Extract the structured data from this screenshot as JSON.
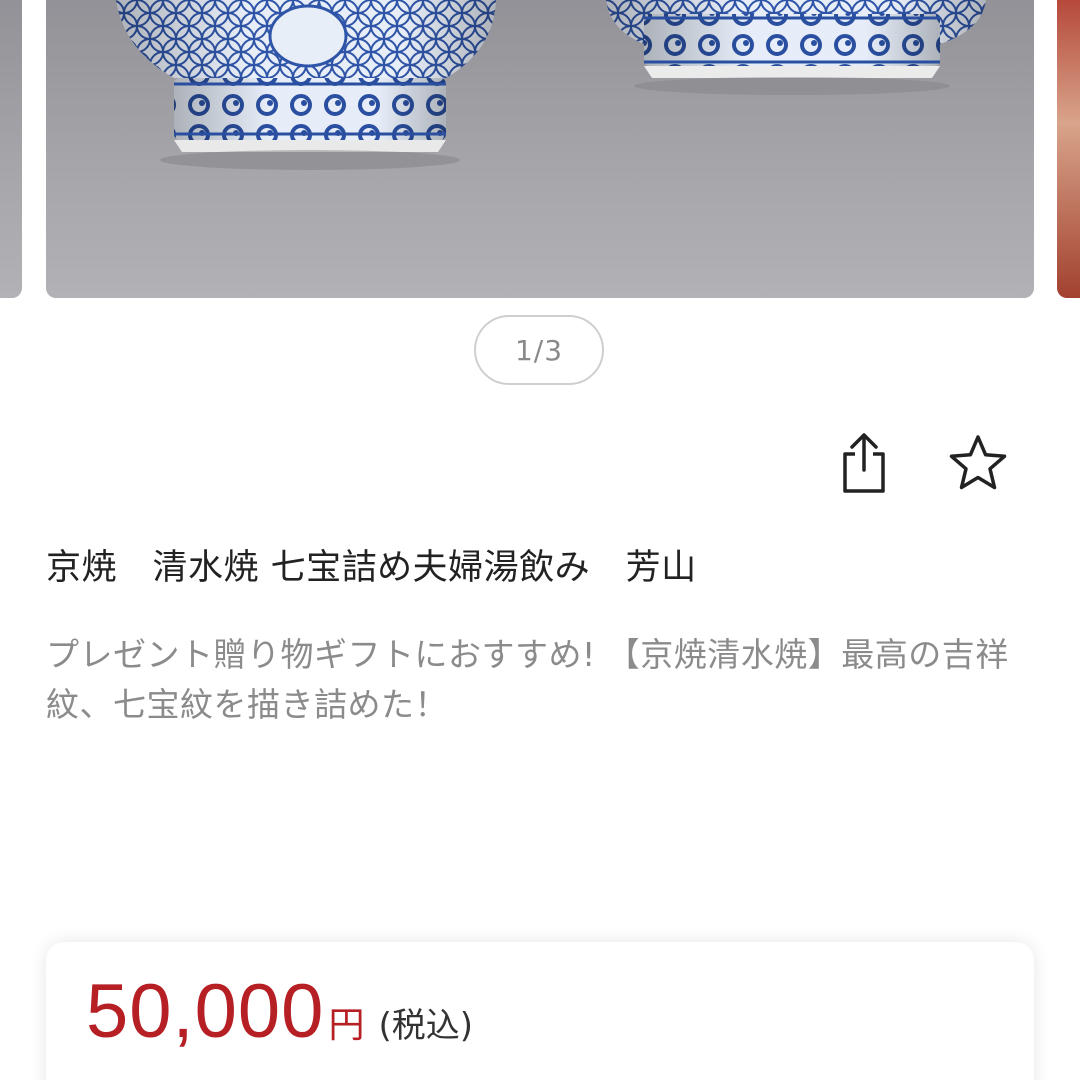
{
  "carousel": {
    "indicator": "1/3"
  },
  "actions": {
    "share_icon": "share-icon",
    "favorite_icon": "star-outline-icon"
  },
  "product": {
    "title": "京焼　清水焼 七宝詰め夫婦湯飲み　芳山",
    "description": "プレゼント贈り物ギフトにおすすめ! 【京焼清水焼】最高の吉祥紋、七宝紋を描き詰めた！"
  },
  "price": {
    "amount": "50,000",
    "currency": "円",
    "tax_note": "(税込)",
    "color": "#b61f24"
  }
}
